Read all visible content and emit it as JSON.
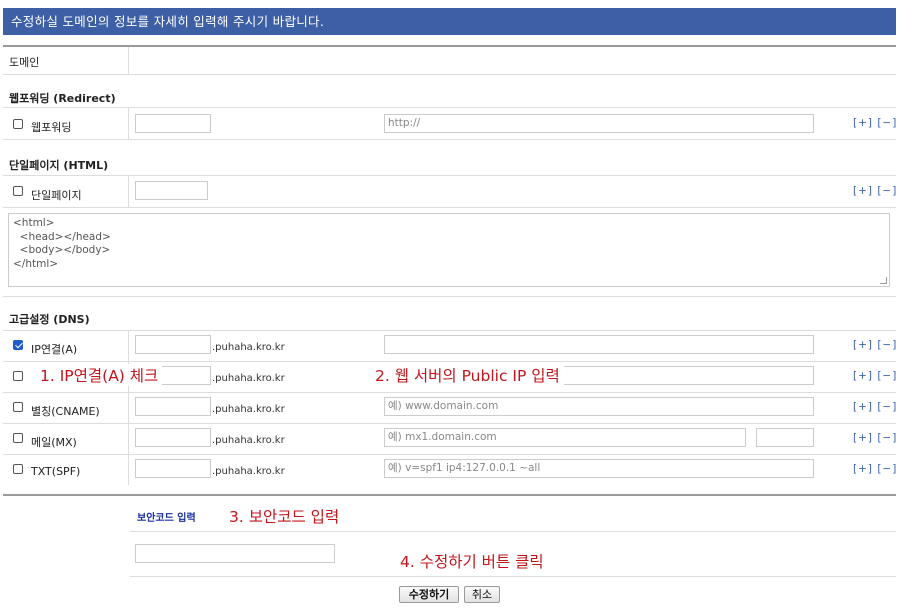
{
  "header": {
    "title": "수정하실 도메인의 정보를 자세히 입력해 주시기 바랍니다."
  },
  "domain": {
    "label": "도메인",
    "value": ""
  },
  "web_forwarding": {
    "section_title": "웹포워딩 (Redirect)",
    "checkbox_label": "웹포워딩",
    "checked": false,
    "subdomain_value": "",
    "url_placeholder": "http://",
    "plus_minus": "[+] [−]"
  },
  "single_page": {
    "section_title": "단일페이지 (HTML)",
    "checkbox_label": "단일페이지",
    "checked": false,
    "plus_minus": "[+] [−]",
    "html_content": "<html>\n  <head></head>\n  <body></body>\n</html>"
  },
  "dns": {
    "section_title": "고급설정 (DNS)",
    "rows": [
      {
        "label": "IP연결(A)",
        "checked": true,
        "suffix": ".puhaha.kro.kr",
        "placeholder": "",
        "plus_minus": "[+] [−]"
      },
      {
        "label": "",
        "checked": false,
        "suffix": ".puhaha.kro.kr",
        "placeholder": "",
        "plus_minus": "[+] [−]"
      },
      {
        "label": "별칭(CNAME)",
        "checked": false,
        "suffix": ".puhaha.kro.kr",
        "placeholder": "예) www.domain.com",
        "plus_minus": "[+] [−]"
      },
      {
        "label": "메일(MX)",
        "checked": false,
        "suffix": ".puhaha.kro.kr",
        "placeholder": "예) mx1.domain.com",
        "plus_minus": "[+] [−]"
      },
      {
        "label": "TXT(SPF)",
        "checked": false,
        "suffix": ".puhaha.kro.kr",
        "placeholder": "예) v=spf1 ip4:127.0.0.1 ~all",
        "plus_minus": "[+] [−]"
      }
    ]
  },
  "security": {
    "label": "보안코드 입력",
    "value": ""
  },
  "buttons": {
    "submit": "수정하기",
    "cancel": "취소"
  },
  "annotations": {
    "step1": "1. IP연결(A) 체크",
    "step2": "2. 웹 서버의 Public IP 입력",
    "step3": "3. 보안코드 입력",
    "step4": "4. 수정하기 버튼 클릭"
  },
  "colors": {
    "header_bg": "#3d5fa5",
    "annotation": "#c0161b",
    "link": "#3a5fb0",
    "security_label": "#1a2fa0"
  }
}
